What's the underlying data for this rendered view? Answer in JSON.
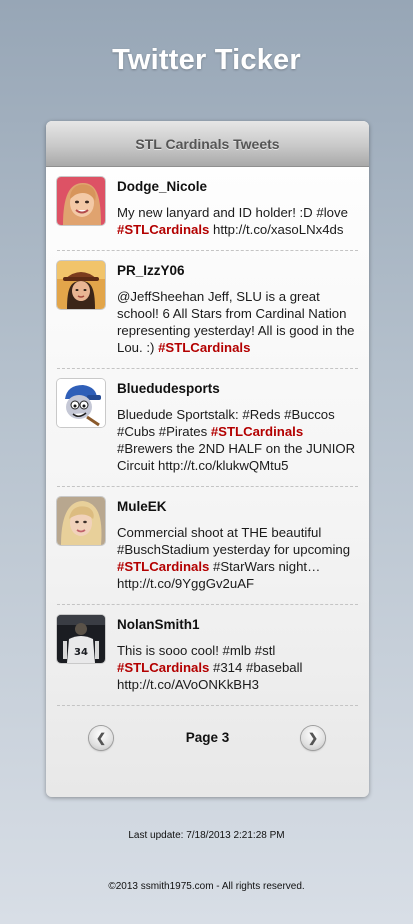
{
  "app": {
    "title": "Twitter Ticker"
  },
  "panel": {
    "header": "STL Cardinals Tweets"
  },
  "tweets": [
    {
      "username": "Dodge_Nicole",
      "avatar": "woman-portrait-avatar",
      "parts": [
        {
          "t": "My new lanyard and ID holder! :D #love "
        },
        {
          "t": "#STLCardinals",
          "tag": true
        },
        {
          "t": " http://t.co/xasoLNx4ds"
        }
      ]
    },
    {
      "username": "PR_IzzY06",
      "avatar": "woman-hat-avatar",
      "parts": [
        {
          "t": "@JeffSheehan Jeff, SLU is a great school! 6 All Stars from Cardinal Nation representing yesterday! All is good in the Lou. :) "
        },
        {
          "t": "#STLCardinals",
          "tag": true
        }
      ]
    },
    {
      "username": "Bluedudesports",
      "avatar": "cartoon-avatar",
      "parts": [
        {
          "t": "Bluedude Sportstalk: #Reds #Buccos #Cubs #Pirates "
        },
        {
          "t": "#STLCardinals",
          "tag": true
        },
        {
          "t": " #Brewers the 2ND HALF on the JUNIOR Circuit http://t.co/klukwQMtu5"
        }
      ]
    },
    {
      "username": "MuleEK",
      "avatar": "blonde-portrait-avatar",
      "parts": [
        {
          "t": "Commercial shoot at THE beautiful #BuschStadium yesterday for upcoming "
        },
        {
          "t": "#STLCardinals",
          "tag": true
        },
        {
          "t": " #StarWars night… http://t.co/9YggGv2uAF"
        }
      ]
    },
    {
      "username": "NolanSmith1",
      "avatar": "player-jersey-avatar",
      "parts": [
        {
          "t": "This is sooo cool! #mlb #stl "
        },
        {
          "t": "#STLCardinals",
          "tag": true
        },
        {
          "t": " #314 #baseball http://t.co/AVoONKkBH3"
        }
      ]
    }
  ],
  "pager": {
    "label": "Page 3",
    "prev_icon": "chevron-left-icon",
    "next_icon": "chevron-right-icon"
  },
  "footer": {
    "last_update": "Last update: 7/18/2013 2:21:28 PM",
    "copyright": "©2013 ssmith1975.com - All rights reserved."
  },
  "colors": {
    "hashtag": "#b30000",
    "title": "#ffffff",
    "header_text": "#555555"
  }
}
